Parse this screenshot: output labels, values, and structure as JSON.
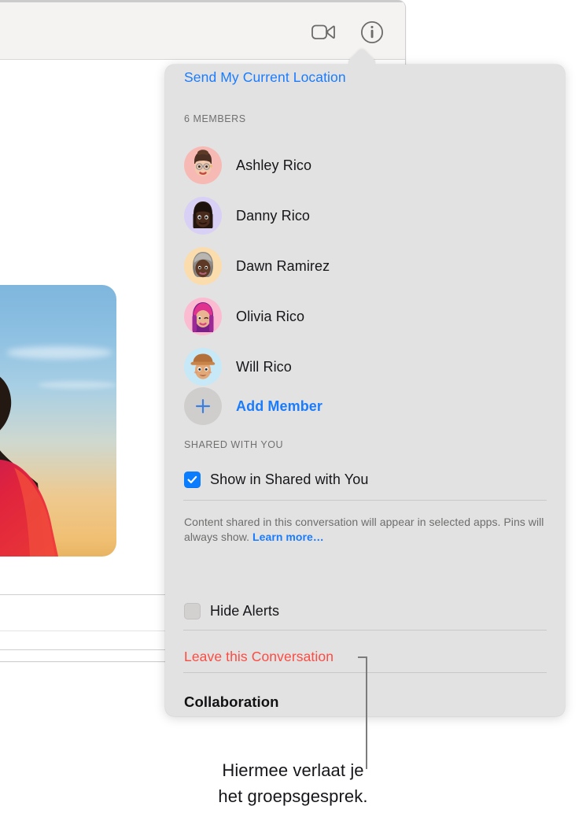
{
  "window": {
    "toolbar": {
      "facetime_icon": "video-camera-icon",
      "info_icon": "info-circle-icon"
    },
    "message_photo_alt": "photo-message-bubble"
  },
  "popover": {
    "send_location": "Send My Current Location",
    "members_header": "6 MEMBERS",
    "members": [
      {
        "name": "Ashley Rico",
        "avatar_bg": "#f7b9b4",
        "avatar": "memoji-ashley"
      },
      {
        "name": "Danny Rico",
        "avatar_bg": "#d9d0f5",
        "avatar": "memoji-danny"
      },
      {
        "name": "Dawn Ramirez",
        "avatar_bg": "#fbdcac",
        "avatar": "memoji-dawn"
      },
      {
        "name": "Olivia Rico",
        "avatar_bg": "#fbbcd2",
        "avatar": "memoji-olivia"
      },
      {
        "name": "Will Rico",
        "avatar_bg": "#c6e8f7",
        "avatar": "memoji-will"
      }
    ],
    "add_member": "Add Member",
    "add_member_icon": "plus-icon",
    "shared_header": "SHARED WITH YOU",
    "show_in_shared": {
      "label": "Show in Shared with You",
      "checked": true
    },
    "note": {
      "text": "Content shared in this conversation will appear in selected apps. Pins will always show.",
      "link": "Learn more…"
    },
    "hide_alerts": {
      "label": "Hide Alerts",
      "checked": false
    },
    "leave_conversation": "Leave this Conversation",
    "collaboration": "Collaboration"
  },
  "callout": {
    "line1": "Hiermee verlaat je",
    "line2": "het groepsgesprek."
  },
  "colors": {
    "accent_blue": "#1a7cfd",
    "destructive_red": "#fc4b42",
    "popover_bg": "#e3e2e2",
    "toolbar_bg": "#f4f3f2",
    "checkbox_on": "#0a7cfe",
    "checkbox_off": "#d2d1d0",
    "secondary_text": "#70706f"
  }
}
